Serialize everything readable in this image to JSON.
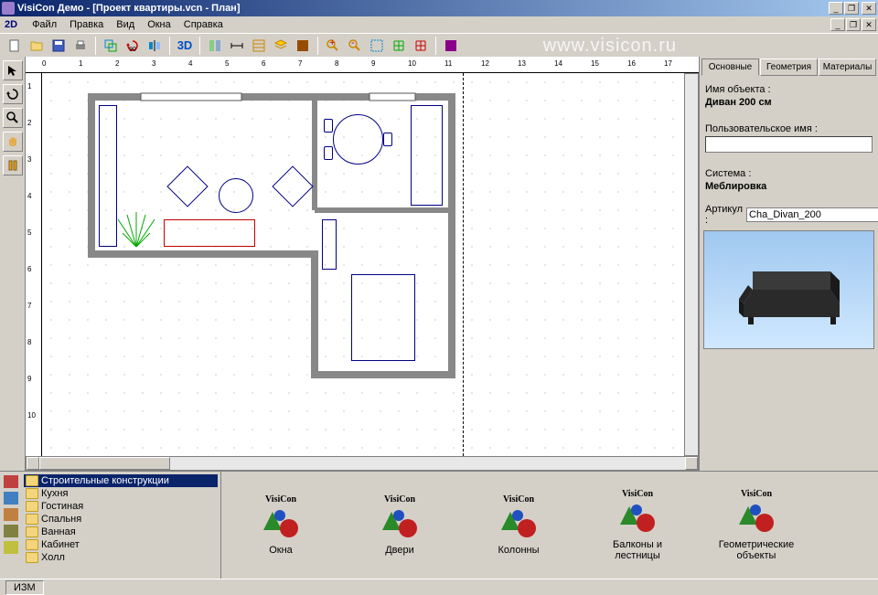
{
  "title": "VisiCon Демо - [Проект квартиры.vcn - План]",
  "watermark": "www.visicon.ru",
  "menu": {
    "file": "Файл",
    "edit": "Правка",
    "view": "Вид",
    "windows": "Окна",
    "help": "Справка"
  },
  "mode_label": "2D",
  "toolbar_3d": "3D",
  "props": {
    "tabs": {
      "basic": "Основные",
      "geometry": "Геометрия",
      "materials": "Материалы"
    },
    "obj_name_label": "Имя объекта :",
    "obj_name_value": "Диван 200 см",
    "user_name_label": "Пользовательское имя :",
    "user_name_value": "",
    "system_label": "Система :",
    "system_value": "Меблировка",
    "sku_label": "Артикул :",
    "sku_value": "Cha_Divan_200"
  },
  "library": {
    "tree": [
      "Строительные конструкции",
      "Кухня",
      "Гостиная",
      "Спальня",
      "Ванная",
      "Кабинет",
      "Холл"
    ],
    "items": [
      {
        "brand": "VisiCon",
        "label": "Окна"
      },
      {
        "brand": "VisiCon",
        "label": "Двери"
      },
      {
        "brand": "VisiCon",
        "label": "Колонны"
      },
      {
        "brand": "VisiCon",
        "label": "Балконы и лестницы"
      },
      {
        "brand": "VisiCon",
        "label": "Геометрические объекты"
      }
    ]
  },
  "status": {
    "mode": "ИЗМ"
  },
  "ruler_h": [
    "0",
    "1",
    "2",
    "3",
    "4",
    "5",
    "6",
    "7",
    "8",
    "9",
    "10",
    "11",
    "12",
    "13",
    "14",
    "15",
    "16",
    "17"
  ],
  "ruler_v": [
    "1",
    "2",
    "3",
    "4",
    "5",
    "6",
    "7",
    "8",
    "9",
    "10"
  ]
}
